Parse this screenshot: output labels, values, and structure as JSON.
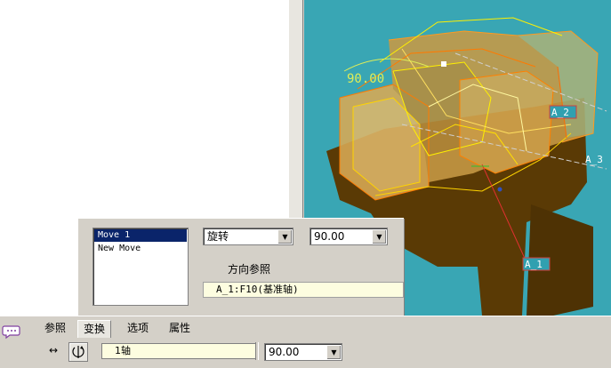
{
  "viewport": {
    "dimension_value": "90.00",
    "axis_labels": [
      "A_2",
      "A_3",
      "A_1"
    ]
  },
  "panel": {
    "moves": [
      "Move 1",
      "New Move"
    ],
    "motion_type": "旋转",
    "angle_value": "90.00",
    "direction_ref_label": "方向参照",
    "direction_ref_value": "A_1:F10(基准轴)"
  },
  "dashboard": {
    "tabs": [
      "参照",
      "变换",
      "选项",
      "属性"
    ],
    "active_tab": "变换",
    "arrows_glyph": "↔",
    "axis_field": "1轴",
    "angle_value": "90.00"
  },
  "icons": [
    "chat-icon",
    "rotate-icon",
    "dropdown-arrow-icon"
  ],
  "colors": {
    "viewport_bg": "#39a6b4",
    "model_dark": "#5a3a05",
    "model_light": "#d2a04a",
    "edge_orange": "#ff7a00",
    "edge_yellow": "#fff000",
    "dimension": "#dfee57",
    "selection": "#0a246a"
  }
}
